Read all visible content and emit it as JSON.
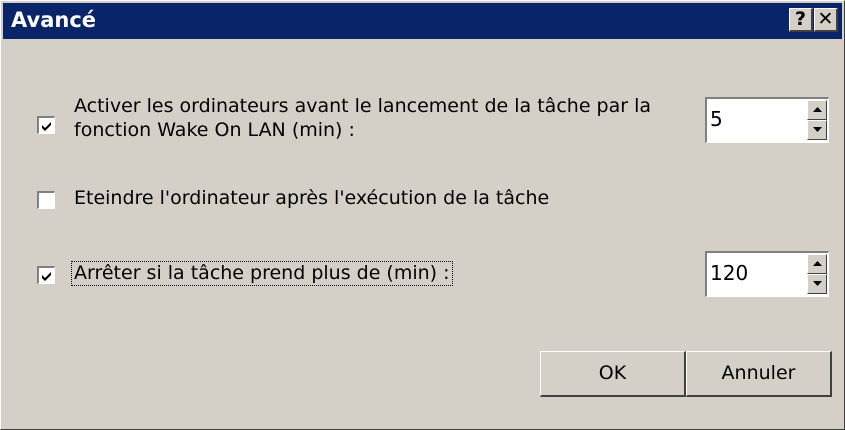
{
  "window": {
    "title": "Avancé",
    "help_button": "?",
    "close_button": "✕"
  },
  "options": {
    "wake_on_lan": {
      "checked": true,
      "label_line1": "Activer les ordinateurs avant le lancement de la tâche par la",
      "label_line2": "fonction Wake On LAN (min) :",
      "value": "5"
    },
    "shutdown": {
      "checked": false,
      "label": "Eteindre l'ordinateur après l'exécution de la tâche"
    },
    "stop_if": {
      "checked": true,
      "label": "Arrêter si la tâche prend plus de (min) :",
      "value": "120"
    }
  },
  "buttons": {
    "ok": "OK",
    "cancel": "Annuler"
  }
}
